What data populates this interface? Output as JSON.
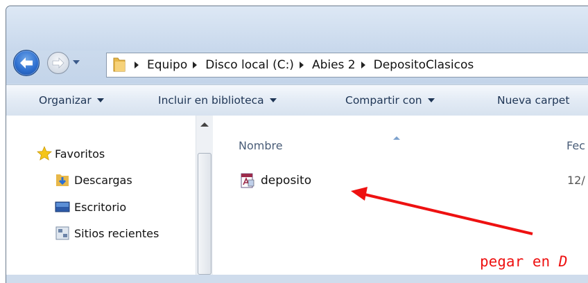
{
  "address": {
    "breadcrumbs": [
      "Equipo",
      "Disco local (C:)",
      "Abies 2",
      "DepositoClasicos"
    ]
  },
  "toolbar": {
    "organize": "Organizar",
    "include_library": "Incluir en biblioteca",
    "share_with": "Compartir con",
    "new_folder": "Nueva carpet"
  },
  "sidebar": {
    "favorites": "Favoritos",
    "items": [
      {
        "label": "Descargas",
        "icon": "downloads-folder-icon"
      },
      {
        "label": "Escritorio",
        "icon": "desktop-icon"
      },
      {
        "label": "Sitios recientes",
        "icon": "recent-places-icon"
      }
    ]
  },
  "file_list": {
    "columns": [
      "Nombre",
      "Fec"
    ],
    "files": [
      {
        "name": "deposito",
        "date": "12/",
        "icon": "access-db-file-icon"
      }
    ]
  },
  "annotation": {
    "text": "pegar en ",
    "text_italic": "D"
  },
  "colors": {
    "annotation": "#ee1111",
    "window_frame": "#cfdcec"
  }
}
